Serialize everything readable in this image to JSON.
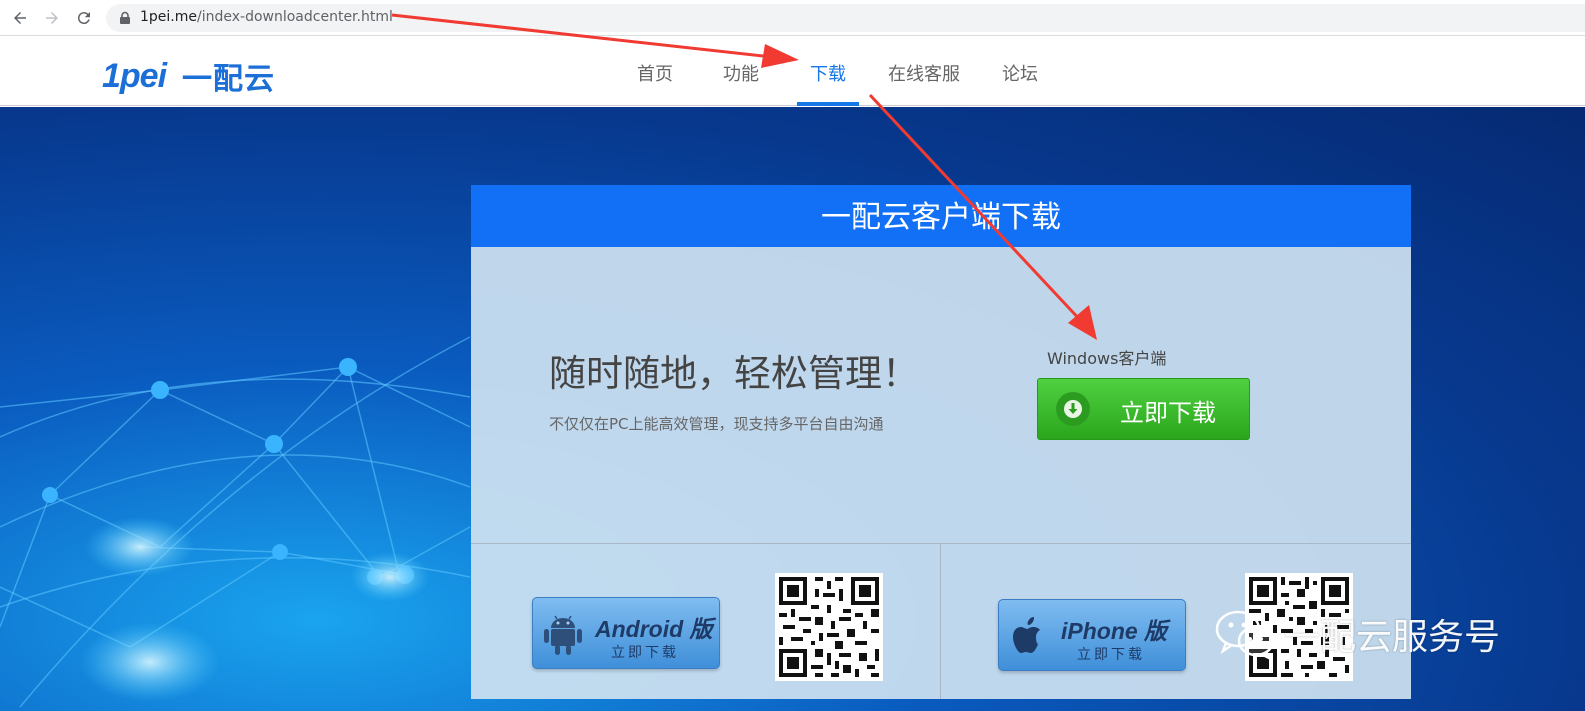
{
  "browser": {
    "url_host": "1pei.me",
    "url_path": "/index-downloadcenter.html"
  },
  "header": {
    "logo_mark": "1pei",
    "logo_text": "一配云",
    "menu": [
      {
        "label": "首页",
        "active": false
      },
      {
        "label": "功能",
        "active": false
      },
      {
        "label": "下载",
        "active": true
      },
      {
        "label": "在线客服",
        "active": false
      },
      {
        "label": "论坛",
        "active": false
      }
    ]
  },
  "panel": {
    "title": "一配云客户端下载",
    "slogan": "随时随地，轻松管理！",
    "subtext": "不仅仅在PC上能高效管理，现支持多平台自由沟通",
    "windows_label": "Windows客户端",
    "download_button": "立即下载",
    "android": {
      "title": "Android 版",
      "sub": "立即下载"
    },
    "iphone": {
      "title": "iPhone 版",
      "sub": "立即下载"
    }
  },
  "watermark": {
    "text": "一配云服务号"
  },
  "colors": {
    "accent": "#1677e8",
    "panel_header": "#1170f5",
    "download_green": "#3cbf2c",
    "arrow_red": "#f03a32"
  },
  "icons": [
    "back-arrow-icon",
    "forward-arrow-icon",
    "reload-icon",
    "lock-icon",
    "download-arrow-icon",
    "android-icon",
    "apple-icon",
    "wechat-icon"
  ]
}
